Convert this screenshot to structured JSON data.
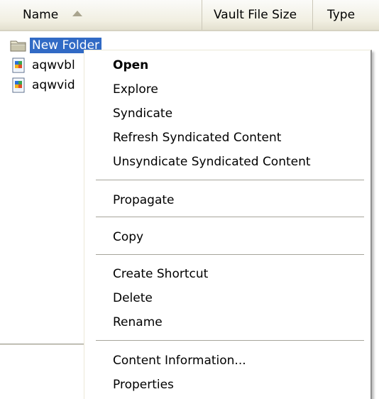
{
  "header": {
    "name_label": "Name",
    "size_label": "Vault File Size",
    "type_label": "Type"
  },
  "files": [
    {
      "name": "New Folder",
      "icon": "folder-icon",
      "selected": true
    },
    {
      "name": "aqwvbl",
      "icon": "document-icon",
      "selected": false
    },
    {
      "name": "aqwvid",
      "icon": "document-icon",
      "selected": false
    }
  ],
  "context_menu": {
    "items": [
      {
        "label": "Open",
        "default": true
      },
      {
        "label": "Explore"
      },
      {
        "label": "Syndicate"
      },
      {
        "label": "Refresh Syndicated Content"
      },
      {
        "label": "Unsyndicate Syndicated Content"
      },
      {
        "label": "Propagate"
      },
      {
        "label": "Copy"
      },
      {
        "label": "Create Shortcut"
      },
      {
        "label": "Delete"
      },
      {
        "label": "Rename"
      },
      {
        "label": "Content Information..."
      },
      {
        "label": "Properties"
      }
    ]
  },
  "colors": {
    "selection": "#316ac5",
    "header_bg": "#f1efe2",
    "menu_border": "#8f8f8f"
  }
}
